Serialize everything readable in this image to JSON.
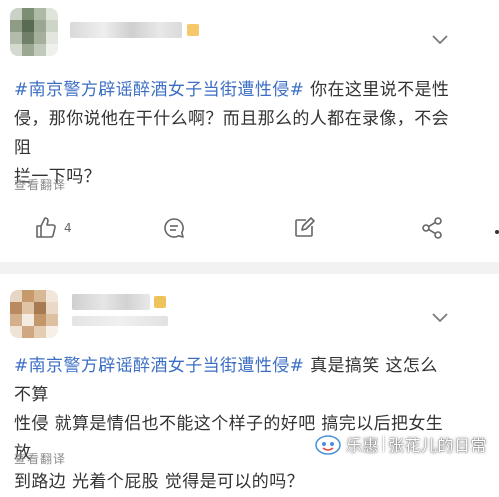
{
  "colors": {
    "hashtag": "#3c6fc4",
    "text": "#333333",
    "muted": "#8a8a8a",
    "separator": "#f2f2f2",
    "icon": "#666666"
  },
  "comment1": {
    "avatar": "pixelated-avatar",
    "username": "",
    "hashtag": "#南京警方辟谣醉酒女子当街遭性侵#",
    "lines": [
      "你在这里说不是性",
      "侵，那你说他在干什么啊？而且那么的人都在录像，不会阻",
      "拦一下吗？"
    ],
    "translate_label": "查看翻译",
    "actions": {
      "like_icon": "thumbs-up-icon",
      "like_count": "4",
      "comment_icon": "comment-icon",
      "repost_icon": "edit-icon",
      "share_icon": "share-icon"
    },
    "menu_icon": "chevron-down-icon"
  },
  "comment2": {
    "avatar": "pixelated-avatar",
    "username": "",
    "hashtag": "#南京警方辟谣醉酒女子当街遭性侵#",
    "lines": [
      "真是搞笑 这怎么不算",
      "性侵 就算是情侣也不能这个样子的好吧 搞完以后把女生放",
      "到路边 光着个屁股 觉得是可以的吗？"
    ],
    "translate_label": "查看翻译",
    "menu_icon": "chevron-down-icon"
  },
  "watermark": {
    "platform": "乐惠",
    "separator": "|",
    "account": "张花儿的日常"
  }
}
